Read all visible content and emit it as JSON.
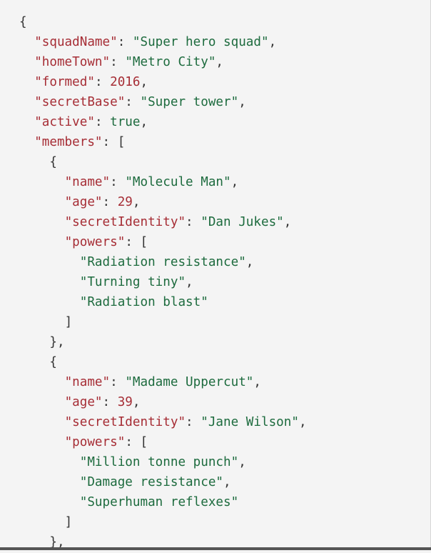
{
  "code": {
    "lines": [
      {
        "indent": 0,
        "open": "{"
      },
      {
        "indent": 1,
        "key": "\"squadName\"",
        "sep": ": ",
        "value": "\"Super hero squad\"",
        "type": "str",
        "tail": ","
      },
      {
        "indent": 1,
        "key": "\"homeTown\"",
        "sep": ": ",
        "value": "\"Metro City\"",
        "type": "str",
        "tail": ","
      },
      {
        "indent": 1,
        "key": "\"formed\"",
        "sep": ": ",
        "value": "2016",
        "type": "num",
        "tail": ","
      },
      {
        "indent": 1,
        "key": "\"secretBase\"",
        "sep": ": ",
        "value": "\"Super tower\"",
        "type": "str",
        "tail": ","
      },
      {
        "indent": 1,
        "key": "\"active\"",
        "sep": ": ",
        "value": "true",
        "type": "bool",
        "tail": ","
      },
      {
        "indent": 1,
        "key": "\"members\"",
        "sep": ": ",
        "value": "",
        "type": "str",
        "tail": "["
      },
      {
        "indent": 2,
        "open": "{"
      },
      {
        "indent": 3,
        "key": "\"name\"",
        "sep": ": ",
        "value": "\"Molecule Man\"",
        "type": "str",
        "tail": ","
      },
      {
        "indent": 3,
        "key": "\"age\"",
        "sep": ": ",
        "value": "29",
        "type": "num",
        "tail": ","
      },
      {
        "indent": 3,
        "key": "\"secretIdentity\"",
        "sep": ": ",
        "value": "\"Dan Jukes\"",
        "type": "str",
        "tail": ","
      },
      {
        "indent": 3,
        "key": "\"powers\"",
        "sep": ": ",
        "value": "",
        "type": "str",
        "tail": "["
      },
      {
        "indent": 4,
        "value": "\"Radiation resistance\"",
        "type": "str",
        "tail": ","
      },
      {
        "indent": 4,
        "value": "\"Turning tiny\"",
        "type": "str",
        "tail": ","
      },
      {
        "indent": 4,
        "value": "\"Radiation blast\"",
        "type": "str",
        "tail": ""
      },
      {
        "indent": 3,
        "open": "]"
      },
      {
        "indent": 2,
        "open": "},"
      },
      {
        "indent": 2,
        "open": "{"
      },
      {
        "indent": 3,
        "key": "\"name\"",
        "sep": ": ",
        "value": "\"Madame Uppercut\"",
        "type": "str",
        "tail": ","
      },
      {
        "indent": 3,
        "key": "\"age\"",
        "sep": ": ",
        "value": "39",
        "type": "num",
        "tail": ","
      },
      {
        "indent": 3,
        "key": "\"secretIdentity\"",
        "sep": ": ",
        "value": "\"Jane Wilson\"",
        "type": "str",
        "tail": ","
      },
      {
        "indent": 3,
        "key": "\"powers\"",
        "sep": ": ",
        "value": "",
        "type": "str",
        "tail": "["
      },
      {
        "indent": 4,
        "value": "\"Million tonne punch\"",
        "type": "str",
        "tail": ","
      },
      {
        "indent": 4,
        "value": "\"Damage resistance\"",
        "type": "str",
        "tail": ","
      },
      {
        "indent": 4,
        "value": "\"Superhuman reflexes\"",
        "type": "str",
        "tail": ""
      },
      {
        "indent": 3,
        "open": "]"
      },
      {
        "indent": 2,
        "open": "},"
      }
    ]
  },
  "colors": {
    "key": "#a62d35",
    "string": "#1d6b3e",
    "number": "#a62d35",
    "punctuation": "#333333",
    "background": "#f4f4f4"
  }
}
